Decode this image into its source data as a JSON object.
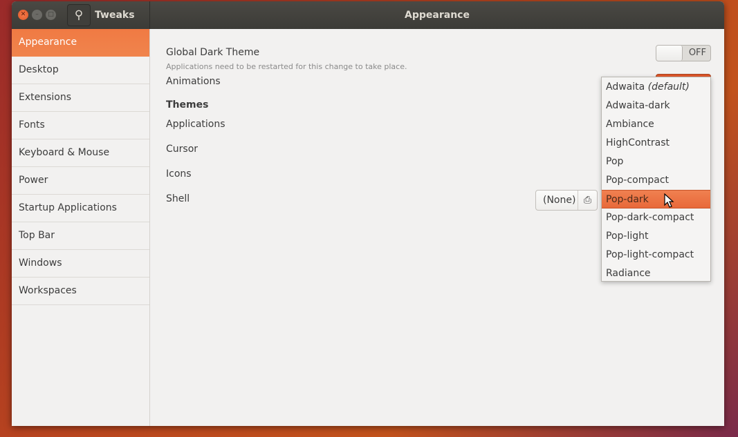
{
  "titlebar": {
    "app_title": "Tweaks",
    "page_title": "Appearance"
  },
  "sidebar": {
    "items": [
      {
        "label": "Appearance",
        "selected": true
      },
      {
        "label": "Desktop"
      },
      {
        "label": "Extensions"
      },
      {
        "label": "Fonts"
      },
      {
        "label": "Keyboard & Mouse"
      },
      {
        "label": "Power"
      },
      {
        "label": "Startup Applications"
      },
      {
        "label": "Top Bar"
      },
      {
        "label": "Windows"
      },
      {
        "label": "Workspaces"
      }
    ]
  },
  "main": {
    "global_dark": {
      "label": "Global Dark Theme",
      "note": "Applications need to be restarted for this change to take place.",
      "toggle": "OFF"
    },
    "animations": {
      "label": "Animations",
      "toggle_on": true
    },
    "themes_heading": "Themes",
    "applications": "Applications",
    "cursor": "Cursor",
    "icons": "Icons",
    "shell": {
      "label": "Shell",
      "value": "(None)"
    }
  },
  "popup": {
    "items": [
      {
        "name": "Adwaita",
        "suffix": "(default)"
      },
      {
        "name": "Adwaita-dark"
      },
      {
        "name": "Ambiance"
      },
      {
        "name": "HighContrast"
      },
      {
        "name": "Pop"
      },
      {
        "name": "Pop-compact"
      },
      {
        "name": "Pop-dark",
        "highlighted": true
      },
      {
        "name": "Pop-dark-compact"
      },
      {
        "name": "Pop-light"
      },
      {
        "name": "Pop-light-compact"
      },
      {
        "name": "Radiance"
      }
    ]
  },
  "colors": {
    "accent": "#f07a43",
    "titlebar": "#3c3b37"
  }
}
